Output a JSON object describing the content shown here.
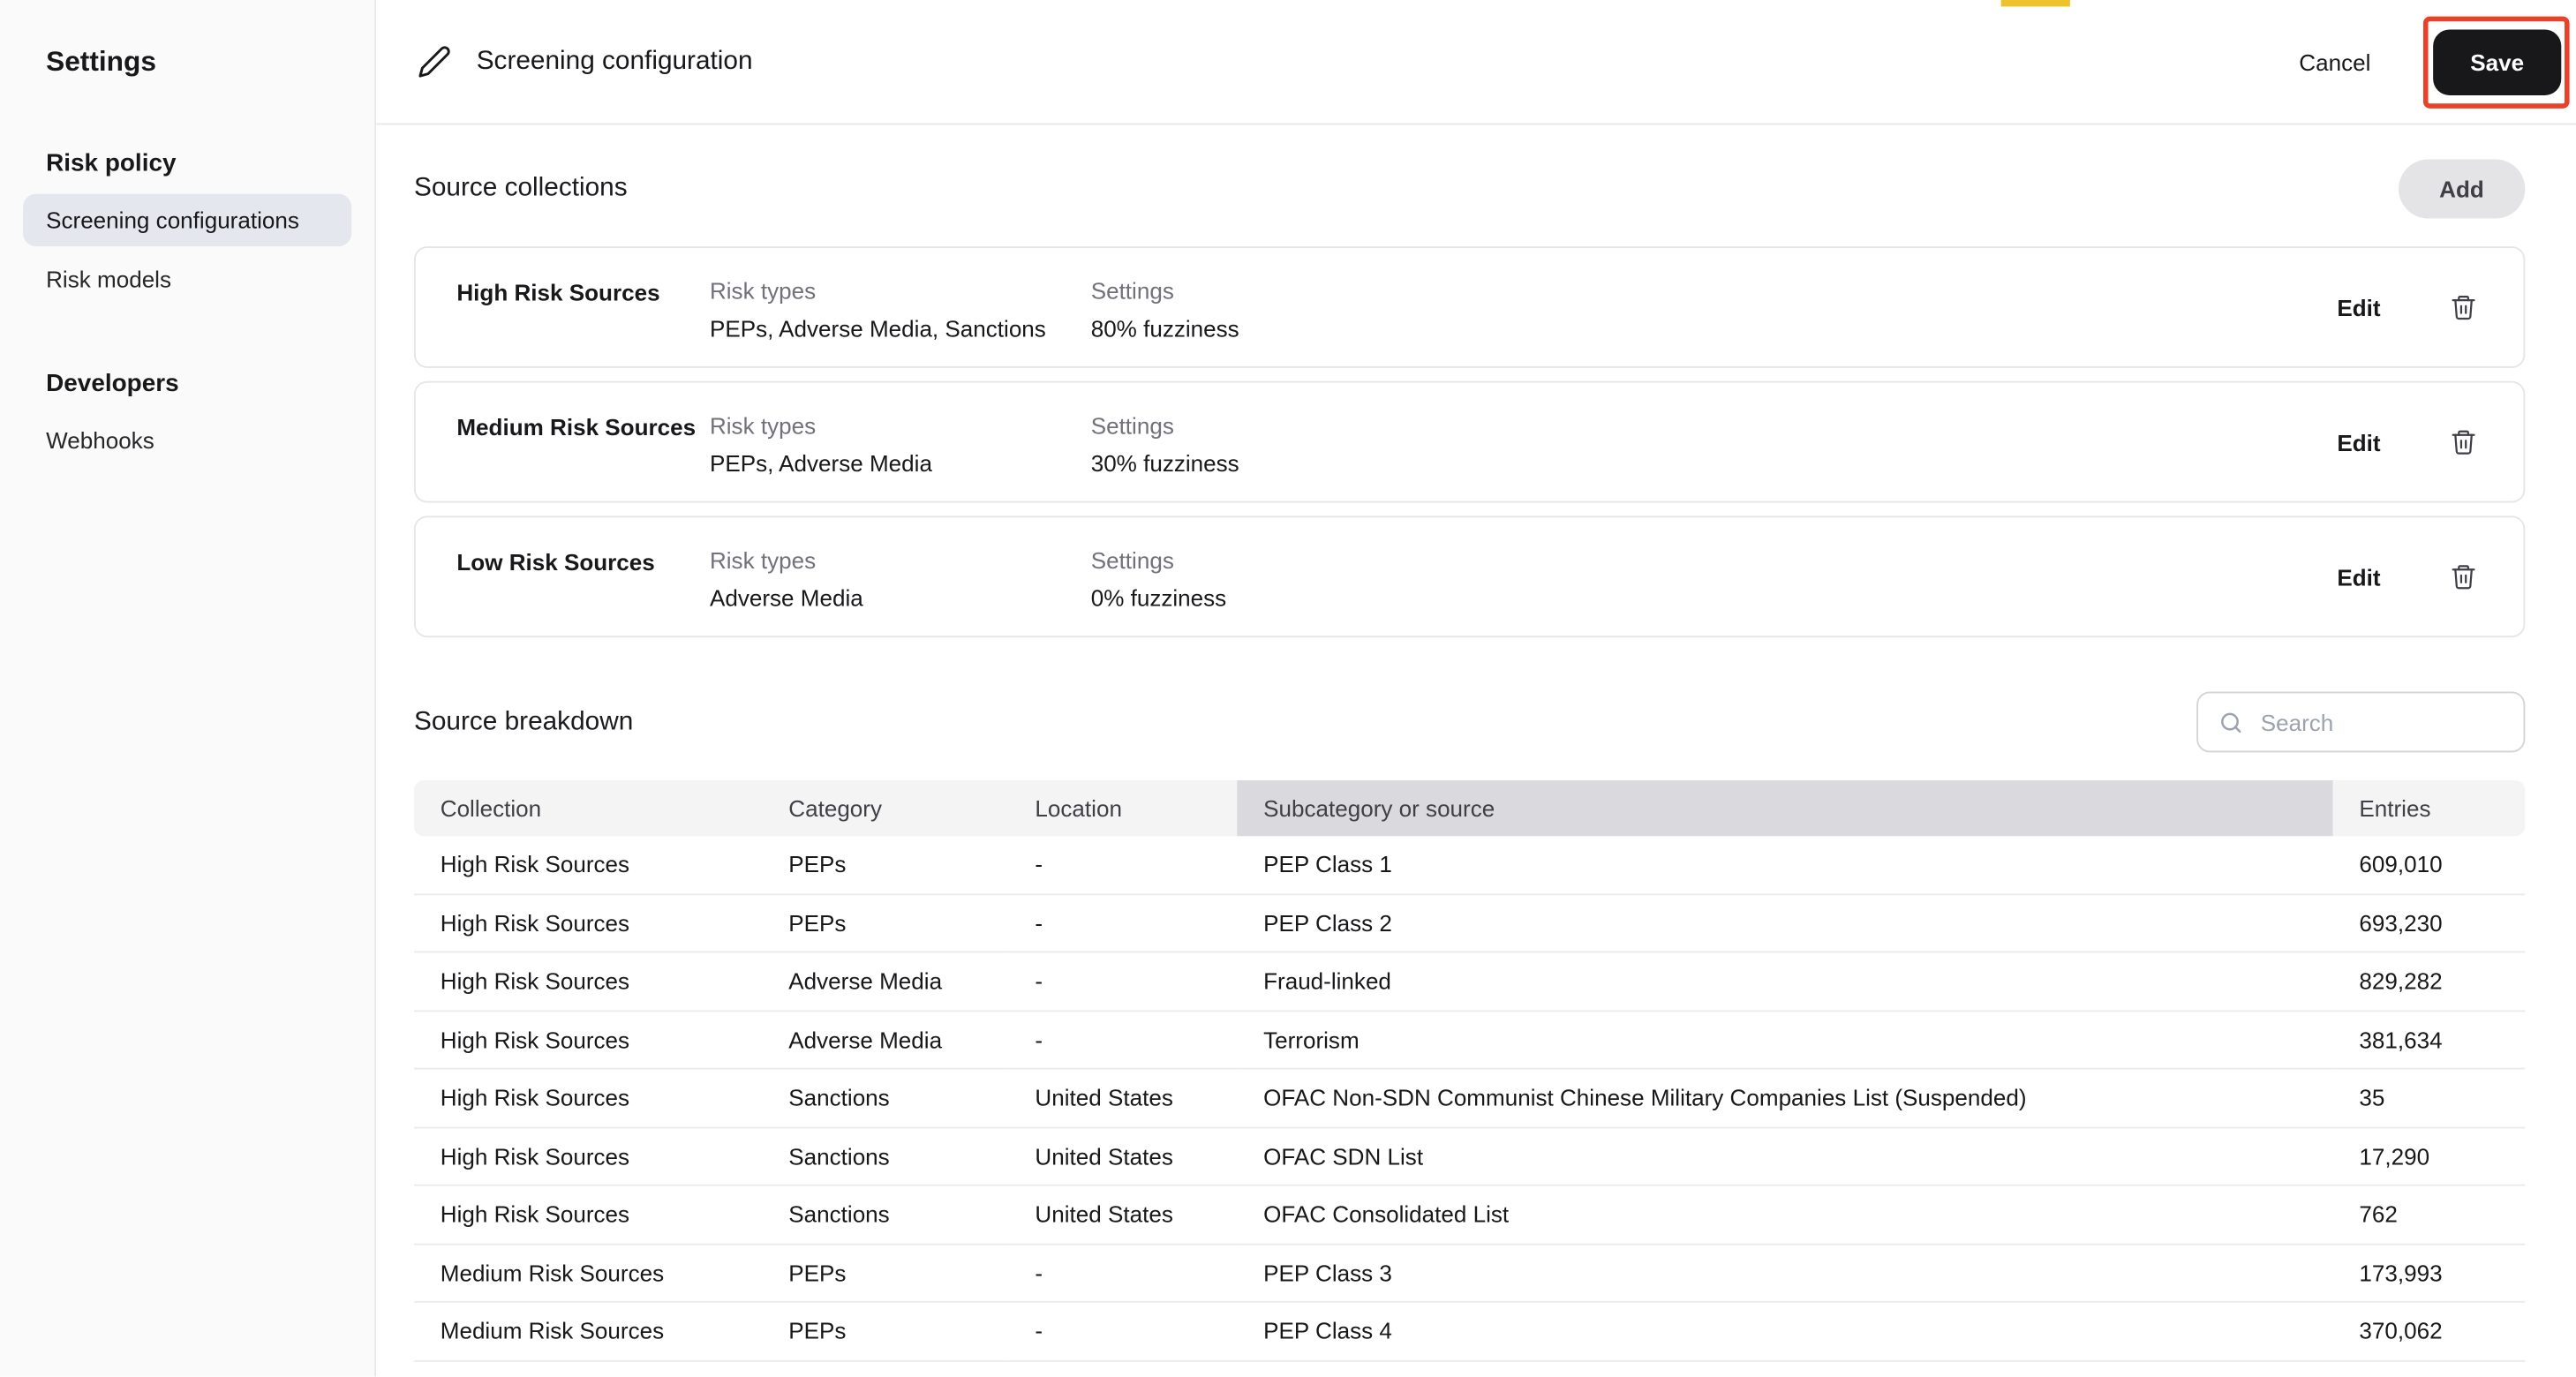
{
  "colors": {
    "save-bg": "#18181b",
    "annotation-red": "#e8432a",
    "top-accent": "#edc32c",
    "active-item-bg": "#e5e7ee",
    "table-header-bg": "#f4f4f5",
    "highlight-col-bg": "#d9d9de"
  },
  "sidebar": {
    "title": "Settings",
    "sections": [
      {
        "heading": "Risk policy",
        "items": [
          {
            "label": "Screening configurations"
          },
          {
            "label": "Risk models"
          }
        ]
      },
      {
        "heading": "Developers",
        "items": [
          {
            "label": "Webhooks"
          }
        ]
      }
    ]
  },
  "header": {
    "title": "Screening configuration",
    "cancel_label": "Cancel",
    "save_label": "Save"
  },
  "source_collections": {
    "heading": "Source collections",
    "add_label": "Add",
    "risk_types_label": "Risk types",
    "settings_label": "Settings",
    "edit_label": "Edit",
    "cards": [
      {
        "name": "High Risk Sources",
        "risk_types": "PEPs, Adverse Media, Sanctions",
        "settings": "80% fuzziness"
      },
      {
        "name": "Medium Risk Sources",
        "risk_types": "PEPs, Adverse Media",
        "settings": "30% fuzziness"
      },
      {
        "name": "Low Risk Sources",
        "risk_types": "Adverse Media",
        "settings": "0% fuzziness"
      }
    ]
  },
  "source_breakdown": {
    "heading": "Source breakdown",
    "search_placeholder": "Search",
    "columns": [
      "Collection",
      "Category",
      "Location",
      "Subcategory or source",
      "Entries"
    ],
    "highlighted_column": "Subcategory or source",
    "highlighted_column_index": 3,
    "rows": [
      [
        "High Risk Sources",
        "PEPs",
        "-",
        "PEP Class 1",
        "609,010"
      ],
      [
        "High Risk Sources",
        "PEPs",
        "-",
        "PEP Class 2",
        "693,230"
      ],
      [
        "High Risk Sources",
        "Adverse Media",
        "-",
        "Fraud-linked",
        "829,282"
      ],
      [
        "High Risk Sources",
        "Adverse Media",
        "-",
        "Terrorism",
        "381,634"
      ],
      [
        "High Risk Sources",
        "Sanctions",
        "United States",
        "OFAC Non-SDN Communist Chinese Military Companies List (Suspended)",
        "35"
      ],
      [
        "High Risk Sources",
        "Sanctions",
        "United States",
        "OFAC SDN List",
        "17,290"
      ],
      [
        "High Risk Sources",
        "Sanctions",
        "United States",
        "OFAC Consolidated List",
        "762"
      ],
      [
        "Medium Risk Sources",
        "PEPs",
        "-",
        "PEP Class 3",
        "173,993"
      ],
      [
        "Medium Risk Sources",
        "PEPs",
        "-",
        "PEP Class 4",
        "370,062"
      ]
    ]
  }
}
